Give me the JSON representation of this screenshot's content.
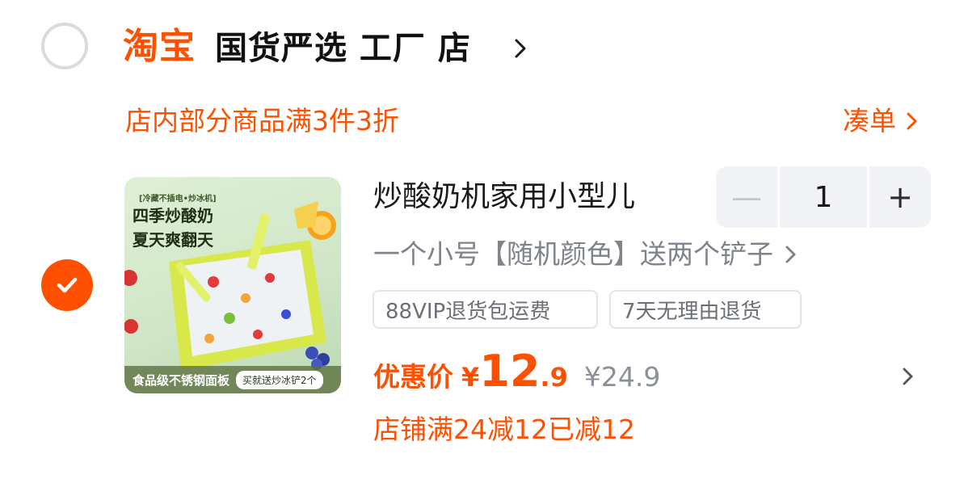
{
  "shop": {
    "platform_logo_text": "淘宝",
    "name": "国货严选 工厂 店",
    "promo_text": "店内部分商品满3件3折",
    "coudan_label": "凑单"
  },
  "item": {
    "selected": true,
    "image_text": {
      "top_badge": "[冷藏不插电•炒冰机]",
      "line1": "四季炒酸奶",
      "line2": "夏天爽翻天",
      "bottom_left": "食品级不锈钢面板",
      "bottom_right": "买就送炒冰铲2个"
    },
    "title": "炒酸奶机家用小型儿",
    "quantity": "1",
    "minus_glyph": "—",
    "plus_glyph": "+",
    "sku": "一个小号【随机颜色】送两个铲子",
    "tags": [
      "88VIP退货包运费",
      "7天无理由退货"
    ],
    "price_label": "优惠价",
    "currency": "¥",
    "price_int": "12",
    "price_dec": ".9",
    "original_price": "¥24.9",
    "discount_text": "店铺满24减12已减12"
  },
  "colors": {
    "accent": "#ff5000",
    "muted_text": "#7f838c",
    "stepper_bg": "#f2f3f6"
  },
  "icons": {
    "check": "check-icon",
    "chevron": "chevron-right-icon"
  }
}
